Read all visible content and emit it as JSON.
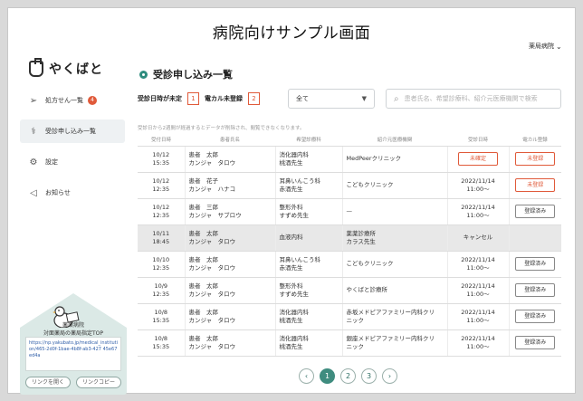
{
  "caption": "病院向けサンプル画面",
  "hospital_menu": "薬局病院",
  "logo": "やくばと",
  "nav": [
    {
      "label": "処方せん一覧",
      "icon": "send-icon",
      "badge": "4"
    },
    {
      "label": "受診申し込み一覧",
      "icon": "stethoscope-icon",
      "badge": ""
    },
    {
      "label": "設定",
      "icon": "gear-icon",
      "badge": ""
    },
    {
      "label": "お知らせ",
      "icon": "megaphone-icon",
      "badge": ""
    }
  ],
  "promo": {
    "name": "薬薬病院",
    "subtitle": "対面薬局の薬局指定TOP",
    "url": "https://np.yakubato.jp/medical_institution/465-2d0f-1bae-4b8f-ab3-427 45e67ed4a",
    "open_button": "リンクを開く",
    "copy_button": "リンクコピー"
  },
  "main": {
    "title": "受診申し込み一覧",
    "filter_unset_label": "受診日時が未定",
    "filter_unset_count": "1",
    "filter_unregistered_label": "電カル未登録",
    "filter_unregistered_count": "2",
    "select_value": "全て",
    "search_placeholder": "患者氏名、希望診療科、紹介元医療機関で検索",
    "note": "受診日から2週間が経過するとデータが削除され、閲覧できなくなります。"
  },
  "table": {
    "headers": [
      "受付日時",
      "患者氏名",
      "希望診療科",
      "紹介元医療機関",
      "受診日時",
      "電カル登録"
    ],
    "rows": [
      {
        "date": "10/12",
        "time": "15:35",
        "name": "患者　太郎",
        "kana": "カンジャ　タロウ",
        "dept": "消化器内科",
        "doctor": "桃酒先生",
        "referrer": "MedPeerクリニック",
        "visit_date": "",
        "visit_time": "",
        "visit_status": "未確定",
        "reg": "未登録",
        "reg_style": "red",
        "dimmed": false
      },
      {
        "date": "10/12",
        "time": "12:35",
        "name": "患者　花子",
        "kana": "カンジャ　ハナコ",
        "dept": "耳鼻いんこう科",
        "doctor": "赤酒先生",
        "referrer": "こどもクリニック",
        "visit_date": "2022/11/14",
        "visit_time": "11:00〜",
        "visit_status": "",
        "reg": "未登録",
        "reg_style": "red",
        "dimmed": false
      },
      {
        "date": "10/12",
        "time": "12:35",
        "name": "患者　三郎",
        "kana": "カンジャ　サブロウ",
        "dept": "整形外科",
        "doctor": "すずめ先生",
        "referrer": "—",
        "visit_date": "2022/11/14",
        "visit_time": "11:00〜",
        "visit_status": "",
        "reg": "登録済み",
        "reg_style": "normal",
        "dimmed": false
      },
      {
        "date": "10/11",
        "time": "18:45",
        "name": "患者　太郎",
        "kana": "カンジャ　タロウ",
        "dept": "血液内科",
        "doctor": "",
        "referrer": "薬薬診療所",
        "referrer2": "カラス先生",
        "visit_date": "",
        "visit_time": "",
        "visit_status": "キャンセル",
        "reg": "",
        "reg_style": "none",
        "dimmed": true
      },
      {
        "date": "10/10",
        "time": "12:35",
        "name": "患者　太郎",
        "kana": "カンジャ　タロウ",
        "dept": "耳鼻いんこう科",
        "doctor": "赤酒先生",
        "referrer": "こどもクリニック",
        "visit_date": "2022/11/14",
        "visit_time": "11:00〜",
        "visit_status": "",
        "reg": "登録済み",
        "reg_style": "normal",
        "dimmed": false
      },
      {
        "date": "10/9",
        "time": "12:35",
        "name": "患者　太郎",
        "kana": "カンジャ　タロウ",
        "dept": "整形外科",
        "doctor": "すずめ先生",
        "referrer": "やくばと診療所",
        "visit_date": "2022/11/14",
        "visit_time": "11:00〜",
        "visit_status": "",
        "reg": "登録済み",
        "reg_style": "normal",
        "dimmed": false
      },
      {
        "date": "10/8",
        "time": "15:35",
        "name": "患者　太郎",
        "kana": "カンジャ　タロウ",
        "dept": "消化器内科",
        "doctor": "桃酒先生",
        "referrer": "赤坂メドピアファミリー内科クリ",
        "referrer2": "ニック",
        "visit_date": "2022/11/14",
        "visit_time": "11:00〜",
        "visit_status": "",
        "reg": "登録済み",
        "reg_style": "normal",
        "dimmed": false
      },
      {
        "date": "10/8",
        "time": "15:35",
        "name": "患者　太郎",
        "kana": "カンジャ　タロウ",
        "dept": "消化器内科",
        "doctor": "桃酒先生",
        "referrer": "銀座メドピアファミリー内科クリ",
        "referrer2": "ニック",
        "visit_date": "2022/11/14",
        "visit_time": "11:00〜",
        "visit_status": "",
        "reg": "登録済み",
        "reg_style": "normal",
        "dimmed": false
      }
    ]
  },
  "pagination": {
    "prev": "‹",
    "pages": [
      "1",
      "2",
      "3"
    ],
    "next": "›",
    "current": "1"
  },
  "colors": {
    "accent": "#3f8c7f",
    "alert": "#e05a3a"
  }
}
